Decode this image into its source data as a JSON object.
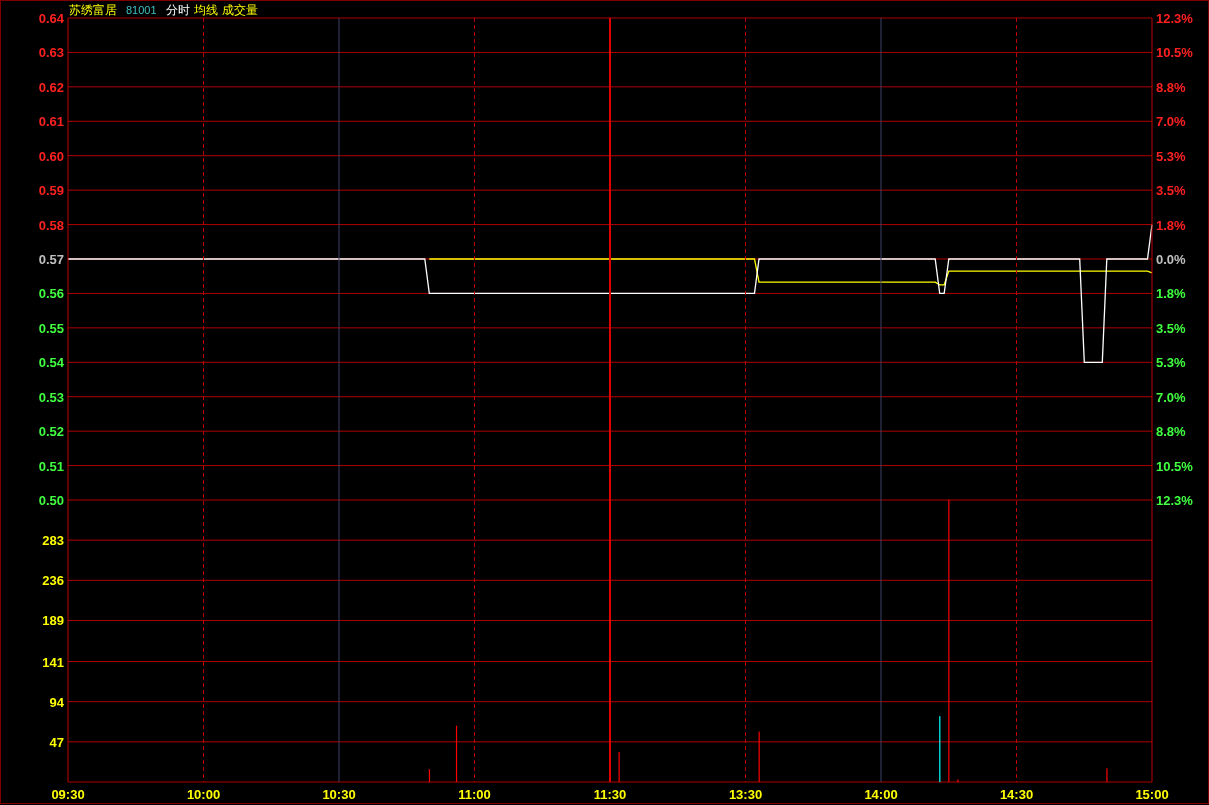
{
  "header": {
    "name": "苏绣富居",
    "code": "81001"
  },
  "price_chart": {
    "chart_data": {
      "type": "line",
      "grid": true,
      "ylim": [
        0.5,
        0.64
      ],
      "yticks": [
        {
          "value": 0.64,
          "label": "0.64"
        },
        {
          "value": 0.63,
          "label": "0.63"
        },
        {
          "value": 0.62,
          "label": "0.62"
        },
        {
          "value": 0.61,
          "label": "0.61"
        },
        {
          "value": 0.6,
          "label": "0.60"
        },
        {
          "value": 0.59,
          "label": "0.59"
        },
        {
          "value": 0.58,
          "label": "0.58"
        },
        {
          "value": 0.57,
          "label": "0.57"
        },
        {
          "value": 0.56,
          "label": "0.56"
        },
        {
          "value": 0.55,
          "label": "0.55"
        },
        {
          "value": 0.54,
          "label": "0.54"
        },
        {
          "value": 0.53,
          "label": "0.53"
        },
        {
          "value": 0.52,
          "label": "0.52"
        },
        {
          "value": 0.51,
          "label": "0.51"
        },
        {
          "value": 0.5,
          "label": "0.50"
        }
      ],
      "categories": [
        null,
        null,
        null,
        null,
        null,
        null,
        null,
        null,
        null,
        null,
        null,
        null,
        null,
        null,
        null,
        null,
        null,
        null,
        null,
        null,
        null,
        null,
        null,
        null,
        null,
        null,
        null,
        null,
        null,
        null,
        null,
        null,
        null,
        null,
        null,
        null,
        null,
        null,
        null,
        null,
        null,
        null,
        null,
        null,
        null,
        null,
        null,
        null,
        null,
        null,
        null,
        null,
        null,
        null,
        null,
        null,
        null,
        null,
        null,
        null,
        null,
        null,
        null,
        null,
        null,
        null,
        null,
        null,
        null,
        null,
        null,
        null,
        null,
        null,
        null,
        null,
        null,
        null,
        null,
        null,
        null,
        null,
        null,
        null,
        null,
        null,
        null,
        null,
        null,
        null,
        null,
        null,
        null,
        null,
        null,
        null,
        null,
        null,
        null,
        null,
        null,
        null,
        null,
        null,
        null,
        null,
        null,
        null,
        null,
        null,
        null,
        null,
        null,
        null,
        null,
        null,
        null,
        null,
        null,
        null,
        null,
        null,
        null,
        null,
        null,
        null,
        null,
        null,
        null,
        null,
        null,
        null,
        null,
        null,
        null,
        null,
        null,
        null,
        null,
        null,
        null,
        null,
        null,
        null,
        null,
        null,
        null,
        null,
        null,
        null,
        null,
        null,
        null,
        null,
        null,
        null,
        null,
        null,
        null,
        null,
        null,
        null,
        null,
        null,
        null,
        null,
        null,
        null,
        null,
        null,
        null,
        null,
        null,
        null,
        null,
        null,
        null,
        null,
        null,
        null,
        null,
        null,
        null,
        null,
        null,
        null,
        null,
        null,
        null,
        null,
        null,
        null,
        null,
        null,
        null,
        null,
        null,
        null,
        null,
        null,
        null,
        null,
        null,
        null,
        null,
        null,
        null,
        null,
        null,
        null,
        null,
        null,
        null,
        null,
        null,
        null,
        null,
        null,
        null,
        null,
        null,
        null,
        null,
        null,
        null,
        null,
        null,
        null,
        null,
        null,
        null,
        null,
        null,
        null,
        null,
        null,
        null,
        null,
        null,
        null,
        null
      ],
      "series": [
        {
          "name": "分时",
          "color": "#ffffff",
          "values": [
            0.57,
            0.57,
            0.57,
            0.57,
            0.57,
            0.57,
            0.57,
            0.57,
            0.57,
            0.57,
            0.57,
            0.57,
            0.57,
            0.57,
            0.57,
            0.57,
            0.57,
            0.57,
            0.57,
            0.57,
            0.57,
            0.57,
            0.57,
            0.57,
            0.57,
            0.57,
            0.57,
            0.57,
            0.57,
            0.57,
            0.57,
            0.57,
            0.57,
            0.57,
            0.57,
            0.57,
            0.57,
            0.57,
            0.57,
            0.57,
            0.57,
            0.57,
            0.57,
            0.57,
            0.57,
            0.57,
            0.57,
            0.57,
            0.57,
            0.57,
            0.57,
            0.57,
            0.57,
            0.57,
            0.57,
            0.57,
            0.57,
            0.57,
            0.57,
            0.57,
            0.57,
            0.57,
            0.57,
            0.57,
            0.57,
            0.57,
            0.57,
            0.57,
            0.57,
            0.57,
            0.57,
            0.57,
            0.57,
            0.57,
            0.57,
            0.57,
            0.57,
            0.57,
            0.57,
            0.57,
            0.56,
            0.56,
            0.56,
            0.56,
            0.56,
            0.56,
            0.56,
            0.56,
            0.56,
            0.56,
            0.56,
            0.56,
            0.56,
            0.56,
            0.56,
            0.56,
            0.56,
            0.56,
            0.56,
            0.56,
            0.56,
            0.56,
            0.56,
            0.56,
            0.56,
            0.56,
            0.56,
            0.56,
            0.56,
            0.56,
            0.56,
            0.56,
            0.56,
            0.56,
            0.56,
            0.56,
            0.56,
            0.56,
            0.56,
            0.56,
            0.56,
            0.56,
            0.56,
            0.56,
            0.56,
            0.56,
            0.56,
            0.56,
            0.56,
            0.56,
            0.56,
            0.56,
            0.56,
            0.56,
            0.56,
            0.56,
            0.56,
            0.56,
            0.56,
            0.56,
            0.56,
            0.56,
            0.56,
            0.56,
            0.56,
            0.56,
            0.56,
            0.56,
            0.56,
            0.56,
            0.56,
            0.56,
            0.56,
            0.57,
            0.57,
            0.57,
            0.57,
            0.57,
            0.57,
            0.57,
            0.57,
            0.57,
            0.57,
            0.57,
            0.57,
            0.57,
            0.57,
            0.57,
            0.57,
            0.57,
            0.57,
            0.57,
            0.57,
            0.57,
            0.57,
            0.57,
            0.57,
            0.57,
            0.57,
            0.57,
            0.57,
            0.57,
            0.57,
            0.57,
            0.57,
            0.57,
            0.57,
            0.57,
            0.57,
            0.57,
            0.57,
            0.57,
            0.57,
            0.56,
            0.56,
            0.57,
            0.57,
            0.57,
            0.57,
            0.57,
            0.57,
            0.57,
            0.57,
            0.57,
            0.57,
            0.57,
            0.57,
            0.57,
            0.57,
            0.57,
            0.57,
            0.57,
            0.57,
            0.57,
            0.57,
            0.57,
            0.57,
            0.57,
            0.57,
            0.57,
            0.57,
            0.57,
            0.57,
            0.57,
            0.57,
            0.54,
            0.54,
            0.54,
            0.54,
            0.54,
            0.57,
            0.57,
            0.57,
            0.57,
            0.57,
            0.57,
            0.57,
            0.57,
            0.57,
            0.57,
            0.58
          ]
        },
        {
          "name": "均线",
          "color": "#ffff00",
          "values": [
            null,
            null,
            null,
            null,
            null,
            null,
            null,
            null,
            null,
            null,
            null,
            null,
            null,
            null,
            null,
            null,
            null,
            null,
            null,
            null,
            null,
            null,
            null,
            null,
            null,
            null,
            null,
            null,
            null,
            null,
            null,
            null,
            null,
            null,
            null,
            null,
            null,
            null,
            null,
            null,
            null,
            null,
            null,
            null,
            null,
            null,
            null,
            null,
            null,
            null,
            null,
            null,
            null,
            null,
            null,
            null,
            null,
            null,
            null,
            null,
            null,
            null,
            null,
            null,
            null,
            null,
            null,
            null,
            null,
            null,
            null,
            null,
            null,
            null,
            null,
            null,
            null,
            null,
            null,
            null,
            0.57,
            0.57,
            0.57,
            0.57,
            0.57,
            0.57,
            0.57,
            0.57,
            0.57,
            0.57,
            0.57,
            0.57,
            0.57,
            0.57,
            0.57,
            0.57,
            0.57,
            0.57,
            0.57,
            0.57,
            0.57,
            0.57,
            0.57,
            0.57,
            0.57,
            0.57,
            0.57,
            0.57,
            0.57,
            0.57,
            0.57,
            0.57,
            0.57,
            0.57,
            0.57,
            0.57,
            0.57,
            0.57,
            0.57,
            0.57,
            0.57,
            0.57,
            0.57,
            0.57,
            0.57,
            0.57,
            0.57,
            0.57,
            0.57,
            0.57,
            0.57,
            0.57,
            0.57,
            0.57,
            0.57,
            0.57,
            0.57,
            0.57,
            0.57,
            0.57,
            0.57,
            0.57,
            0.57,
            0.57,
            0.57,
            0.57,
            0.57,
            0.57,
            0.57,
            0.57,
            0.57,
            0.57,
            0.57,
            0.5633,
            0.5633,
            0.5633,
            0.5633,
            0.5633,
            0.5633,
            0.5633,
            0.5633,
            0.5633,
            0.5633,
            0.5633,
            0.5633,
            0.5633,
            0.5633,
            0.5633,
            0.5633,
            0.5633,
            0.5633,
            0.5633,
            0.5633,
            0.5633,
            0.5633,
            0.5633,
            0.5633,
            0.5633,
            0.5633,
            0.5633,
            0.5633,
            0.5633,
            0.5633,
            0.5633,
            0.5633,
            0.5633,
            0.5633,
            0.5633,
            0.5633,
            0.5633,
            0.5633,
            0.5633,
            0.5633,
            0.5625,
            0.5625,
            0.5665,
            0.5665,
            0.5665,
            0.5665,
            0.5665,
            0.5665,
            0.5665,
            0.5665,
            0.5665,
            0.5665,
            0.5665,
            0.5665,
            0.5665,
            0.5665,
            0.5665,
            0.5665,
            0.5665,
            0.5665,
            0.5665,
            0.5665,
            0.5665,
            0.5665,
            0.5665,
            0.5665,
            0.5665,
            0.5665,
            0.5665,
            0.5665,
            0.5665,
            0.5665,
            0.5665,
            0.5665,
            0.5665,
            0.5665,
            0.5665,
            0.5665,
            0.5665,
            0.5665,
            0.5665,
            0.5665,
            0.5665,
            0.5665,
            0.5665,
            0.5665,
            0.5665,
            0.566
          ]
        }
      ]
    },
    "percent_axis": [
      "12.3%",
      "10.5%",
      "8.8%",
      "7.0%",
      "5.3%",
      "3.5%",
      "1.8%",
      "0.0%",
      "1.8%",
      "3.5%",
      "5.3%",
      "7.0%",
      "8.8%",
      "10.5%",
      "12.3%"
    ]
  },
  "volume_chart": {
    "chart_data": {
      "type": "bar",
      "title": "成交量",
      "grid": true,
      "ylim": [
        0,
        330
      ],
      "yticks": [
        {
          "value": 283,
          "label": "283"
        },
        {
          "value": 236,
          "label": "236"
        },
        {
          "value": 189,
          "label": "189"
        },
        {
          "value": 141,
          "label": "141"
        },
        {
          "value": 94,
          "label": "94"
        },
        {
          "value": 47,
          "label": "47"
        }
      ],
      "categories": [
        "09:30",
        null,
        null,
        null,
        null,
        null,
        null,
        null,
        null,
        null,
        null,
        null,
        null,
        null,
        null,
        null,
        null,
        null,
        null,
        null,
        null,
        null,
        null,
        null,
        null,
        null,
        null,
        null,
        null,
        null,
        "10:00",
        null,
        null,
        null,
        null,
        null,
        null,
        null,
        null,
        null,
        null,
        null,
        null,
        null,
        null,
        null,
        null,
        null,
        null,
        null,
        null,
        null,
        null,
        null,
        null,
        null,
        null,
        null,
        null,
        null,
        "10:30",
        null,
        null,
        null,
        null,
        null,
        null,
        null,
        null,
        null,
        null,
        null,
        null,
        null,
        null,
        null,
        null,
        null,
        null,
        null,
        null,
        null,
        null,
        null,
        null,
        null,
        null,
        null,
        null,
        null,
        "11:00",
        null,
        null,
        null,
        null,
        null,
        null,
        null,
        null,
        null,
        null,
        null,
        null,
        null,
        null,
        null,
        null,
        null,
        null,
        null,
        null,
        null,
        null,
        null,
        null,
        null,
        null,
        null,
        null,
        null,
        "11:30",
        null,
        null,
        null,
        null,
        null,
        null,
        null,
        null,
        null,
        null,
        null,
        null,
        null,
        null,
        null,
        null,
        null,
        null,
        null,
        null,
        null,
        null,
        null,
        null,
        null,
        null,
        null,
        null,
        null,
        "13:30",
        null,
        null,
        null,
        null,
        null,
        null,
        null,
        null,
        null,
        null,
        null,
        null,
        null,
        null,
        null,
        null,
        null,
        null,
        null,
        null,
        null,
        null,
        null,
        null,
        null,
        null,
        null,
        null,
        null,
        "14:00",
        null,
        null,
        null,
        null,
        null,
        null,
        null,
        null,
        null,
        null,
        null,
        null,
        null,
        null,
        null,
        null,
        null,
        null,
        null,
        null,
        null,
        null,
        null,
        null,
        null,
        null,
        null,
        null,
        null,
        "14:30",
        null,
        null,
        null,
        null,
        null,
        null,
        null,
        null,
        null,
        null,
        null,
        null,
        null,
        null,
        null,
        null,
        null,
        null,
        null,
        null,
        null,
        null,
        null,
        null,
        null,
        null,
        null,
        null,
        null,
        "15:00"
      ],
      "series": [
        {
          "color": "#ff0000",
          "values": [
            null,
            null,
            null,
            null,
            null,
            null,
            null,
            null,
            null,
            null,
            null,
            null,
            null,
            null,
            null,
            null,
            null,
            null,
            null,
            null,
            null,
            null,
            null,
            null,
            null,
            null,
            null,
            null,
            null,
            null,
            null,
            null,
            null,
            null,
            null,
            null,
            null,
            null,
            null,
            null,
            null,
            null,
            null,
            null,
            null,
            null,
            null,
            null,
            null,
            null,
            null,
            null,
            null,
            null,
            null,
            null,
            null,
            null,
            null,
            null,
            null,
            null,
            null,
            null,
            null,
            null,
            null,
            null,
            null,
            null,
            null,
            null,
            null,
            null,
            null,
            null,
            null,
            null,
            null,
            null,
            15,
            null,
            null,
            null,
            null,
            null,
            66,
            null,
            null,
            null,
            null,
            null,
            null,
            null,
            null,
            null,
            null,
            null,
            null,
            null,
            null,
            null,
            null,
            null,
            null,
            null,
            null,
            null,
            null,
            null,
            null,
            null,
            null,
            null,
            null,
            null,
            null,
            null,
            null,
            null,
            null,
            null,
            35,
            null,
            null,
            null,
            null,
            null,
            null,
            null,
            null,
            null,
            null,
            null,
            null,
            null,
            null,
            null,
            null,
            null,
            null,
            null,
            null,
            null,
            null,
            null,
            null,
            null,
            null,
            null,
            null,
            null,
            null,
            59,
            null,
            null,
            null,
            null,
            null,
            null,
            null,
            null,
            null,
            null,
            null,
            null,
            null,
            null,
            null,
            null,
            null,
            null,
            null,
            null,
            null,
            null,
            null,
            null,
            null,
            null,
            null,
            null,
            null,
            null,
            null,
            null,
            null,
            null,
            null,
            null,
            null,
            null,
            null,
            null,
            null,
            330,
            null,
            3,
            null,
            null,
            null,
            null,
            null,
            null,
            null,
            null,
            null,
            null,
            null,
            null,
            null,
            null,
            null,
            null,
            null,
            null,
            null,
            null,
            null,
            null,
            null,
            null,
            null,
            null,
            null,
            null,
            null,
            null,
            null,
            null,
            16,
            null,
            null,
            null,
            null,
            null,
            null,
            null,
            null,
            null,
            null
          ]
        },
        {
          "color": "#00ffff",
          "values": [
            null,
            null,
            null,
            null,
            null,
            null,
            null,
            null,
            null,
            null,
            null,
            null,
            null,
            null,
            null,
            null,
            null,
            null,
            null,
            null,
            null,
            null,
            null,
            null,
            null,
            null,
            null,
            null,
            null,
            null,
            null,
            null,
            null,
            null,
            null,
            null,
            null,
            null,
            null,
            null,
            null,
            null,
            null,
            null,
            null,
            null,
            null,
            null,
            null,
            null,
            null,
            null,
            null,
            null,
            null,
            null,
            null,
            null,
            null,
            null,
            null,
            null,
            null,
            null,
            null,
            null,
            null,
            null,
            null,
            null,
            null,
            null,
            null,
            null,
            null,
            null,
            null,
            null,
            null,
            null,
            null,
            null,
            null,
            null,
            null,
            null,
            null,
            null,
            null,
            null,
            null,
            null,
            null,
            null,
            null,
            null,
            null,
            null,
            null,
            null,
            null,
            null,
            null,
            null,
            null,
            null,
            null,
            null,
            null,
            null,
            null,
            null,
            null,
            null,
            null,
            null,
            null,
            null,
            null,
            null,
            null,
            null,
            null,
            null,
            null,
            null,
            null,
            null,
            null,
            null,
            null,
            null,
            null,
            null,
            null,
            null,
            null,
            null,
            null,
            null,
            null,
            null,
            null,
            null,
            null,
            null,
            null,
            null,
            null,
            null,
            null,
            null,
            null,
            null,
            null,
            null,
            null,
            null,
            null,
            null,
            null,
            null,
            null,
            null,
            null,
            null,
            null,
            null,
            null,
            null,
            null,
            null,
            null,
            null,
            null,
            null,
            null,
            null,
            null,
            null,
            null,
            null,
            null,
            null,
            null,
            null,
            null,
            null,
            null,
            null,
            null,
            null,
            null,
            77,
            null,
            null,
            null,
            null,
            null,
            null,
            null,
            null,
            null,
            null,
            null,
            null,
            null,
            null,
            null,
            null,
            null,
            null,
            null,
            null,
            null,
            null,
            null,
            null,
            null,
            null,
            null,
            null,
            null,
            null,
            null,
            null,
            null,
            null,
            null,
            null,
            null,
            null,
            null,
            null,
            null,
            null,
            null,
            null,
            null,
            null,
            null
          ]
        }
      ]
    }
  }
}
